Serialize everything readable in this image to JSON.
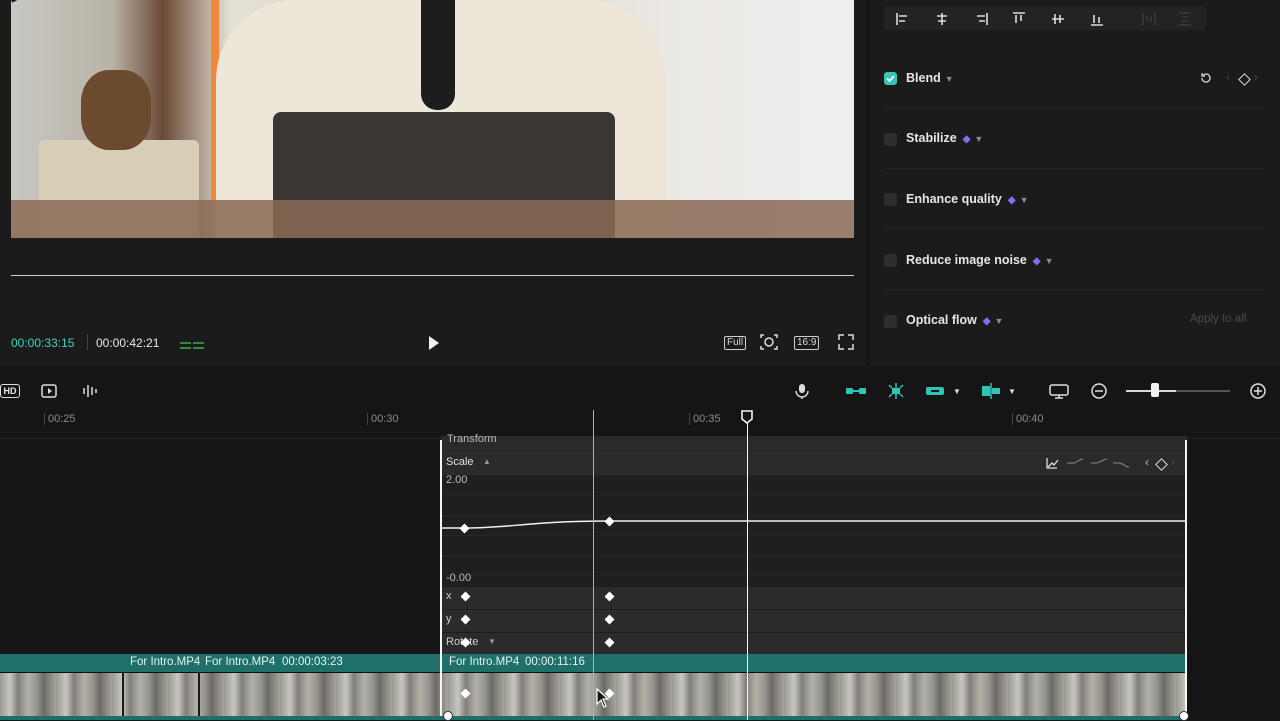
{
  "preview": {
    "timecode_current": "00:00:33:15",
    "timecode_total": "00:00:42:21",
    "controls": {
      "full_label": "Full",
      "ratio_label": "16:9"
    },
    "accent_color": "#3fd1c2"
  },
  "inspector": {
    "options": [
      {
        "label": "Blend",
        "checked": true,
        "premium": false
      },
      {
        "label": "Stabilize",
        "checked": false,
        "premium": true
      },
      {
        "label": "Enhance quality",
        "checked": false,
        "premium": true
      },
      {
        "label": "Reduce image noise",
        "checked": false,
        "premium": true
      },
      {
        "label": "Optical flow",
        "checked": false,
        "premium": true
      }
    ],
    "apply_all_label": "Apply to all"
  },
  "toolbar": {
    "hd_label": "HD"
  },
  "ruler": {
    "ticks": [
      "00:25",
      "00:30",
      "00:35",
      "00:40"
    ]
  },
  "keyframes": {
    "section_label": "Transform",
    "scale_label": "Scale",
    "graph_max": "2.00",
    "graph_min": "-0.00",
    "params": [
      "x",
      "y",
      "Rotate"
    ]
  },
  "clips": [
    {
      "name": "For Intro.MP4"
    },
    {
      "name": "For Intro.MP4",
      "duration": "00:00:03:23"
    },
    {
      "name": "For Intro.MP4",
      "duration": "00:00:11:16"
    }
  ]
}
